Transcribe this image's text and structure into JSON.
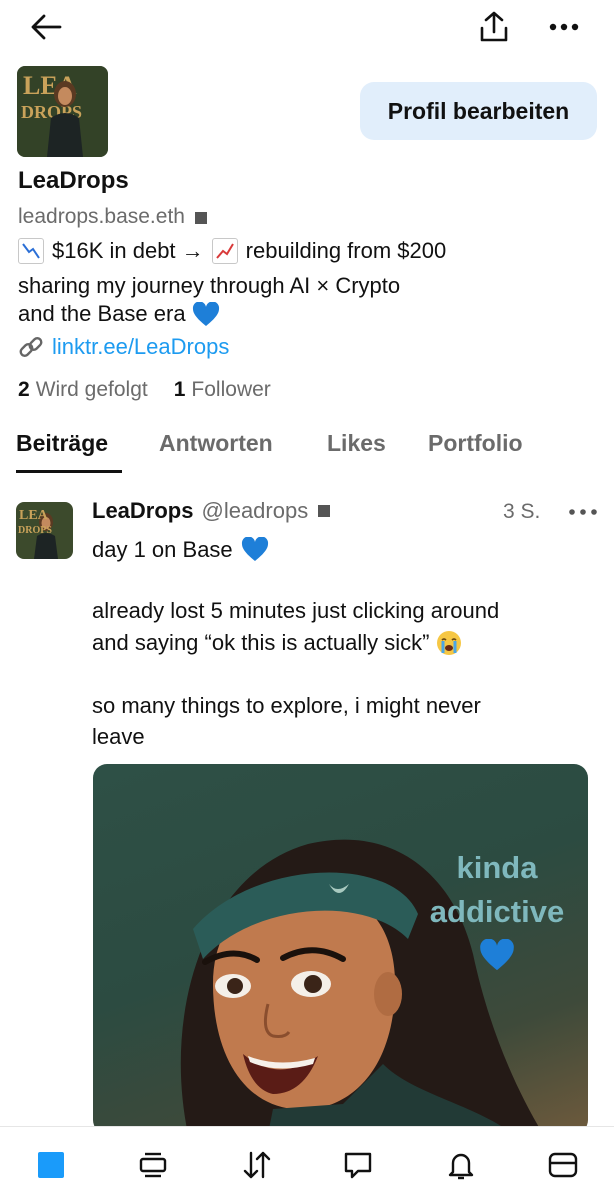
{
  "profile": {
    "display_name": "LeaDrops",
    "handle": "leadrops.base.eth",
    "edit_button": "Profil bearbeiten",
    "bio_line1": "$16K in debt →",
    "bio_line1b": "rebuilding from $200",
    "bio_line2": "sharing my journey through AI × Crypto",
    "bio_line3": "and the Base era",
    "link": "linktr.ee/LeaDrops",
    "following_count": "2",
    "following_label": "Wird gefolgt",
    "followers_count": "1",
    "followers_label": "Follower",
    "avatar_text_top": "LEA",
    "avatar_text_bottom": "DROPS"
  },
  "tabs": [
    {
      "label": "Beiträge",
      "active": true
    },
    {
      "label": "Antworten",
      "active": false
    },
    {
      "label": "Likes",
      "active": false
    },
    {
      "label": "Portfolio",
      "active": false
    }
  ],
  "post": {
    "author_name": "LeaDrops",
    "author_handle": "@leadrops",
    "time": "3 S.",
    "line1": "day 1 on Base",
    "line2": "already lost 5 minutes just clicking around",
    "line3": "and saying “ok this is actually sick”",
    "line4": "so many things to explore, i might never",
    "line5": "leave",
    "image_text_line1": "kinda",
    "image_text_line2": "addictive"
  },
  "icons": {
    "back": "arrow-left-icon",
    "share": "share-icon",
    "more": "more-horizontal-icon"
  },
  "colors": {
    "accent": "#1d9bf0",
    "edit_button_bg": "#e1eefb",
    "heart": "#1e7fd8",
    "nav_active": "#1a9bfa"
  }
}
